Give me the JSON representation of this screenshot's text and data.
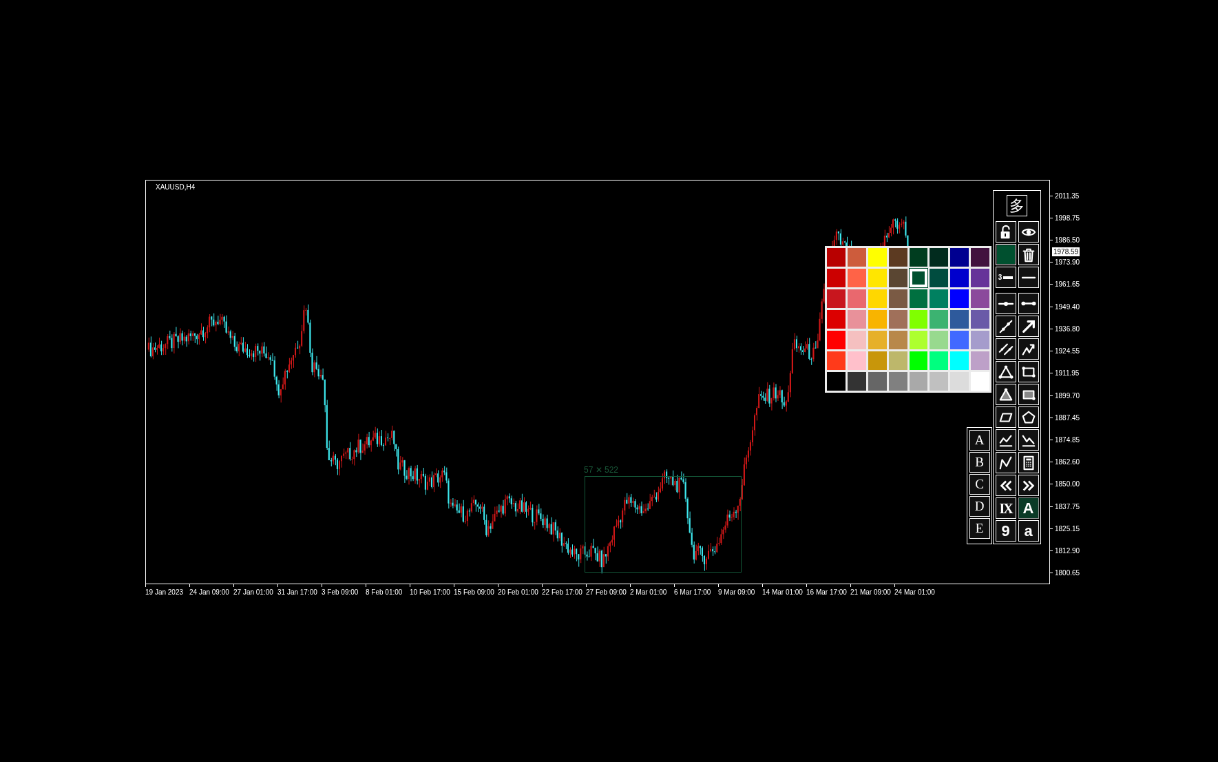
{
  "chart": {
    "symbol": "XAUUSD,H4",
    "current_price": "1978.59",
    "price_labels": [
      "2011.35",
      "1998.75",
      "1986.50",
      "1973.90",
      "1961.65",
      "1949.40",
      "1936.80",
      "1924.55",
      "1911.95",
      "1899.70",
      "1887.45",
      "1874.85",
      "1862.60",
      "1850.00",
      "1837.75",
      "1825.15",
      "1812.90",
      "1800.65"
    ],
    "time_labels": [
      "19 Jan 2023",
      "24 Jan 09:00",
      "27 Jan 01:00",
      "31 Jan 17:00",
      "3 Feb 09:00",
      "8 Feb 01:00",
      "10 Feb 17:00",
      "15 Feb 09:00",
      "20 Feb 01:00",
      "22 Feb 17:00",
      "27 Feb 09:00",
      "2 Mar 01:00",
      "6 Mar 17:00",
      "9 Mar 09:00",
      "14 Mar 01:00",
      "16 Mar 17:00",
      "21 Mar 09:00",
      "24 Mar 01:00"
    ],
    "selection": {
      "label": "57 ✕ 522"
    }
  },
  "toolbar": {
    "title": "多",
    "tools": [
      {
        "kind": "lock",
        "selected": false
      },
      {
        "kind": "eye",
        "selected": false
      },
      {
        "kind": "swatch",
        "color": "#00502f",
        "selected": false
      },
      {
        "kind": "trash",
        "selected": false
      },
      {
        "kind": "labelline",
        "label": "3",
        "selected": false
      },
      {
        "kind": "hline",
        "selected": false
      },
      {
        "kind": "midpoint",
        "selected": false
      },
      {
        "kind": "segment",
        "selected": false
      },
      {
        "kind": "trendline",
        "selected": false
      },
      {
        "kind": "arrow",
        "selected": false
      },
      {
        "kind": "channel",
        "selected": false
      },
      {
        "kind": "zigzag",
        "selected": false
      },
      {
        "kind": "triangle",
        "selected": false
      },
      {
        "kind": "rectangle",
        "selected": false
      },
      {
        "kind": "filledtriangle",
        "selected": false
      },
      {
        "kind": "filledrectangle",
        "selected": false
      },
      {
        "kind": "parallelogram",
        "selected": false
      },
      {
        "kind": "pentagon",
        "selected": false
      },
      {
        "kind": "waveup",
        "selected": false
      },
      {
        "kind": "wavedown",
        "selected": false
      },
      {
        "kind": "polyline",
        "selected": false
      },
      {
        "kind": "calculator",
        "selected": false
      },
      {
        "kind": "chevronleft",
        "selected": false
      },
      {
        "kind": "chevronright",
        "selected": false
      },
      {
        "kind": "text",
        "label": "IX",
        "selected": false
      },
      {
        "kind": "text",
        "label": "A",
        "selected": true
      },
      {
        "kind": "text",
        "label": "9",
        "selected": false
      },
      {
        "kind": "text",
        "label": "a",
        "selected": false
      }
    ]
  },
  "letter_buttons": [
    {
      "label": "A"
    },
    {
      "label": "B"
    },
    {
      "label": "C"
    },
    {
      "label": "D"
    },
    {
      "label": "E"
    }
  ],
  "palette": [
    {
      "color": "#b80000",
      "selected": false
    },
    {
      "color": "#cd5c3c",
      "selected": false
    },
    {
      "color": "#ffff00",
      "selected": false
    },
    {
      "color": "#5c3a21",
      "selected": false
    },
    {
      "color": "#003d1f",
      "selected": false
    },
    {
      "color": "#012b1e",
      "selected": false
    },
    {
      "color": "#000090",
      "selected": false
    },
    {
      "color": "#42123f",
      "selected": false
    },
    {
      "color": "#cc0000",
      "selected": false
    },
    {
      "color": "#ff6347",
      "selected": false
    },
    {
      "color": "#ffe600",
      "selected": false
    },
    {
      "color": "#5a4632",
      "selected": false
    },
    {
      "color": "#00502f",
      "selected": true
    },
    {
      "color": "#004c3f",
      "selected": false
    },
    {
      "color": "#0000cd",
      "selected": false
    },
    {
      "color": "#663399",
      "selected": false
    },
    {
      "color": "#c8161e",
      "selected": false
    },
    {
      "color": "#e9686e",
      "selected": false
    },
    {
      "color": "#ffd700",
      "selected": false
    },
    {
      "color": "#7a5a44",
      "selected": false
    },
    {
      "color": "#007040",
      "selected": false
    },
    {
      "color": "#008060",
      "selected": false
    },
    {
      "color": "#0000ff",
      "selected": false
    },
    {
      "color": "#8b4a9c",
      "selected": false
    },
    {
      "color": "#dc0000",
      "selected": false
    },
    {
      "color": "#e8919a",
      "selected": false
    },
    {
      "color": "#f8b400",
      "selected": false
    },
    {
      "color": "#a0705a",
      "selected": false
    },
    {
      "color": "#80ff00",
      "selected": false
    },
    {
      "color": "#3cb371",
      "selected": false
    },
    {
      "color": "#2e5a9c",
      "selected": false
    },
    {
      "color": "#6a5aa8",
      "selected": false
    },
    {
      "color": "#ff0000",
      "selected": false
    },
    {
      "color": "#f5c0c0",
      "selected": false
    },
    {
      "color": "#e6b02a",
      "selected": false
    },
    {
      "color": "#b8884a",
      "selected": false
    },
    {
      "color": "#adff2f",
      "selected": false
    },
    {
      "color": "#98d98e",
      "selected": false
    },
    {
      "color": "#4169ff",
      "selected": false
    },
    {
      "color": "#a59ccc",
      "selected": false
    },
    {
      "color": "#ff3a1a",
      "selected": false
    },
    {
      "color": "#ffc0cb",
      "selected": false
    },
    {
      "color": "#c8960a",
      "selected": false
    },
    {
      "color": "#bdb76b",
      "selected": false
    },
    {
      "color": "#00ff00",
      "selected": false
    },
    {
      "color": "#00ff7f",
      "selected": false
    },
    {
      "color": "#00ffff",
      "selected": false
    },
    {
      "color": "#bda0c8",
      "selected": false
    },
    {
      "color": "#000000",
      "selected": false
    },
    {
      "color": "#333333",
      "selected": false
    },
    {
      "color": "#666666",
      "selected": false
    },
    {
      "color": "#808080",
      "selected": false
    },
    {
      "color": "#a9a9a9",
      "selected": false
    },
    {
      "color": "#c0c0c0",
      "selected": false
    },
    {
      "color": "#dcdcdc",
      "selected": false
    },
    {
      "color": "#ffffff",
      "selected": false
    }
  ]
}
